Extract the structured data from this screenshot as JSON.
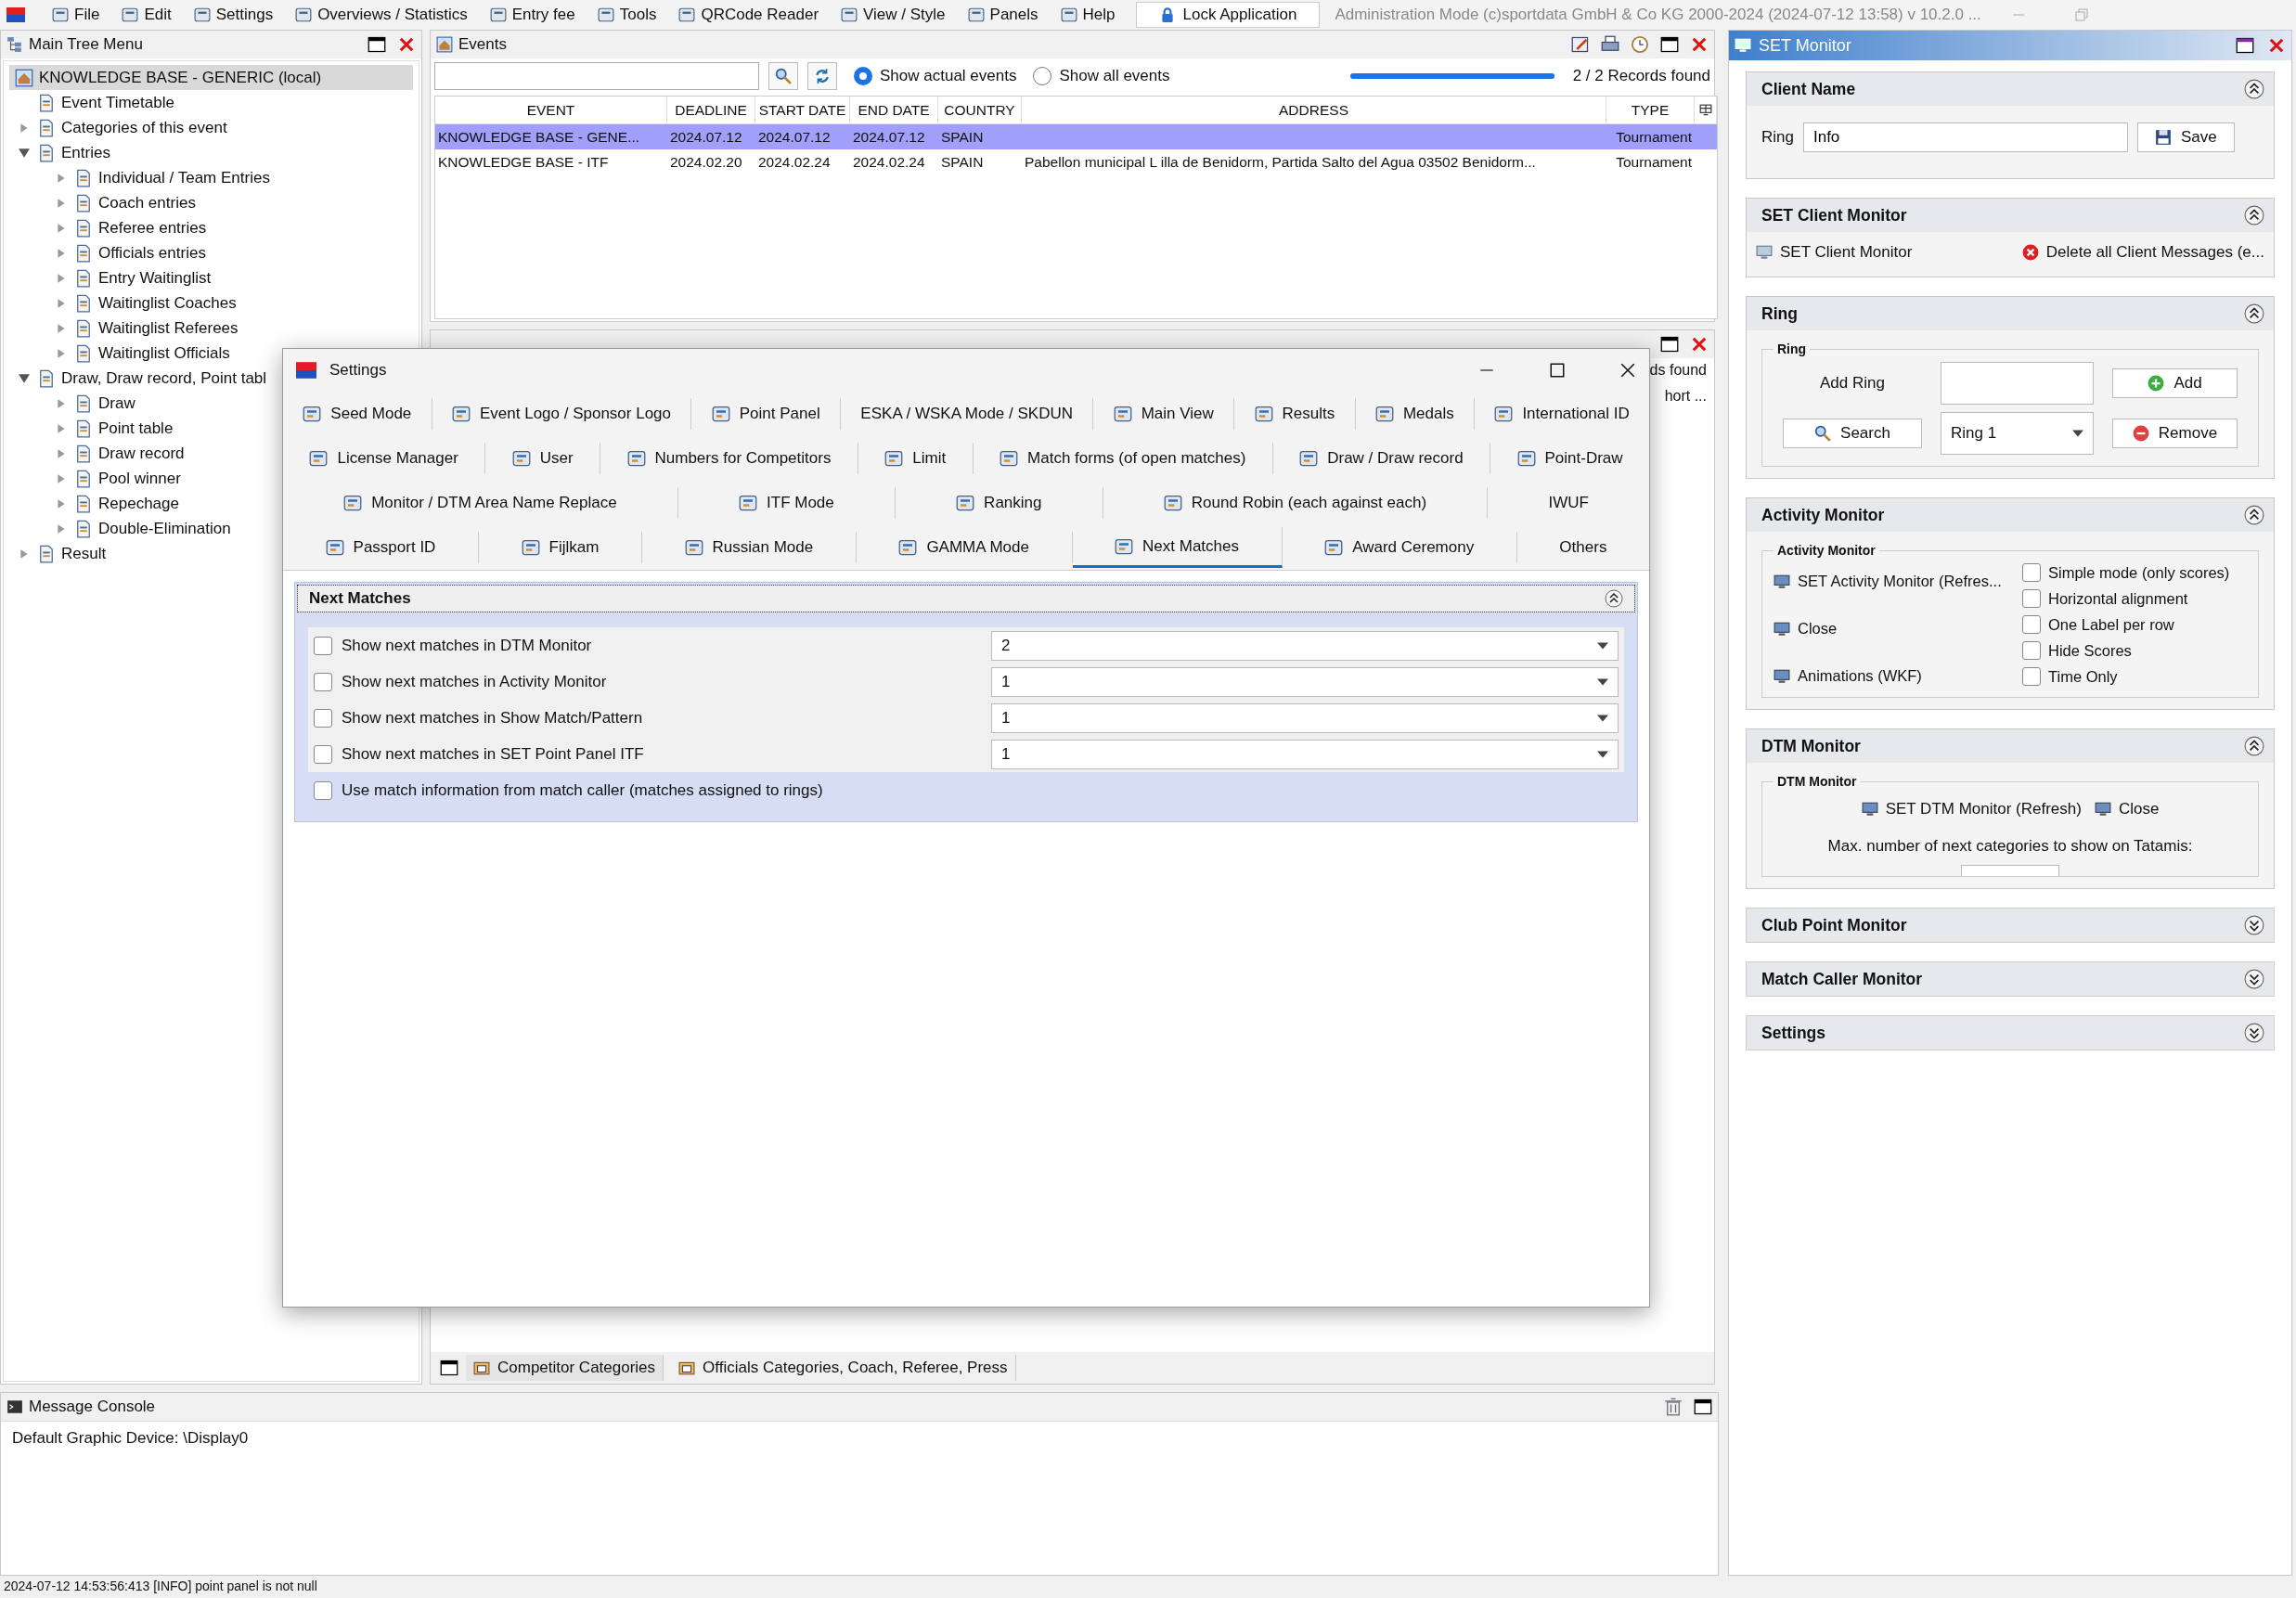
{
  "menu_bar": {
    "items": [
      "File",
      "Edit",
      "Settings",
      "Overviews / Statistics",
      "Entry fee",
      "Tools",
      "QRCode Reader",
      "View / Style",
      "Panels",
      "Help"
    ],
    "lock_button": "Lock Application",
    "caption": "Administration Mode (c)sportdata GmbH & Co KG 2000-2024 (2024-07-12 13:58)  v 10.2.0 ..."
  },
  "tree_panel": {
    "title": "Main Tree Menu",
    "root": {
      "label": "KNOWLEDGE BASE - GENERIC (local)",
      "selected": true
    },
    "items": [
      {
        "label": "Event Timetable",
        "kind": "leaf"
      },
      {
        "label": "Categories of this event",
        "kind": "node",
        "expanded": false
      },
      {
        "label": "Entries",
        "kind": "node",
        "expanded": true,
        "children": [
          {
            "label": "Individual / Team Entries",
            "kind": "node",
            "expanded": false
          },
          {
            "label": "Coach entries",
            "kind": "node",
            "expanded": false
          },
          {
            "label": "Referee entries",
            "kind": "node",
            "expanded": false
          },
          {
            "label": "Officials entries",
            "kind": "node",
            "expanded": false
          },
          {
            "label": "Entry Waitinglist",
            "kind": "node",
            "expanded": false
          },
          {
            "label": "Waitinglist Coaches",
            "kind": "node",
            "expanded": false
          },
          {
            "label": "Waitinglist Referees",
            "kind": "node",
            "expanded": false
          },
          {
            "label": "Waitinglist Officials",
            "kind": "node",
            "expanded": false
          }
        ]
      },
      {
        "label": "Draw, Draw record, Point tabl",
        "kind": "node",
        "expanded": true,
        "children": [
          {
            "label": "Draw",
            "kind": "node",
            "expanded": false
          },
          {
            "label": "Point table",
            "kind": "node",
            "expanded": false
          },
          {
            "label": "Draw record",
            "kind": "node",
            "expanded": false
          },
          {
            "label": "Pool winner",
            "kind": "node",
            "expanded": false
          },
          {
            "label": "Repechage",
            "kind": "node",
            "expanded": false
          },
          {
            "label": "Double-Elimination",
            "kind": "node",
            "expanded": false
          }
        ]
      },
      {
        "label": "Result",
        "kind": "node",
        "expanded": false
      }
    ]
  },
  "events_panel": {
    "title": "Events",
    "radios": [
      {
        "label": "Show actual events",
        "selected": true
      },
      {
        "label": "Show all events",
        "selected": false
      }
    ],
    "progress": {
      "level": 1
    },
    "record_count": "2 / 2 Records found",
    "columns": [
      "EVENT",
      "DEADLINE",
      "START DATE",
      "END DATE",
      "COUNTRY",
      "ADDRESS",
      "TYPE"
    ],
    "rows": [
      {
        "selected": true,
        "cells": [
          "KNOWLEDGE BASE - GENE...",
          "2024.07.12",
          "2024.07.12",
          "2024.07.12",
          "SPAIN",
          null,
          "Tournament"
        ]
      },
      {
        "selected": false,
        "cells": [
          "KNOWLEDGE BASE - ITF",
          "2024.02.20",
          "2024.02.24",
          "2024.02.24",
          "SPAIN",
          "Pabellon municipal L illa de Benidorm, Partida Salto del Agua 03502 Benidorm...",
          "Tournament"
        ]
      }
    ]
  },
  "categories_panel": {
    "record_count": "ds found",
    "column_header": "hort ...",
    "tabs": [
      {
        "label": "Competitor Categories",
        "selected": true
      },
      {
        "label": "Officials Categories, Coach, Referee, Press",
        "selected": false
      }
    ]
  },
  "settings_dialog": {
    "title": "Settings",
    "tab_rows": [
      [
        {
          "label": "Seed Mode",
          "icon": true,
          "selected": false
        },
        {
          "label": "Event Logo / Sponsor Logo",
          "icon": true,
          "selected": false
        },
        {
          "label": "Point Panel",
          "icon": true,
          "selected": false
        },
        {
          "label": "ESKA / WSKA Mode / SKDUN",
          "icon": false,
          "selected": false
        },
        {
          "label": "Main View",
          "icon": true,
          "selected": false
        },
        {
          "label": "Results",
          "icon": true,
          "selected": false
        },
        {
          "label": "Medals",
          "icon": true,
          "selected": false
        },
        {
          "label": "International ID",
          "icon": true,
          "selected": false
        }
      ],
      [
        {
          "label": "License Manager",
          "icon": true,
          "selected": false
        },
        {
          "label": "User",
          "icon": true,
          "selected": false
        },
        {
          "label": "Numbers for Competitors",
          "icon": true,
          "selected": false
        },
        {
          "label": "Limit",
          "icon": true,
          "selected": false
        },
        {
          "label": "Match forms (of open matches)",
          "icon": true,
          "selected": false
        },
        {
          "label": "Draw / Draw record",
          "icon": true,
          "selected": false
        },
        {
          "label": "Point-Draw",
          "icon": true,
          "selected": false
        }
      ],
      [
        {
          "label": "Monitor / DTM Area Name Replace",
          "icon": true,
          "selected": false
        },
        {
          "label": "ITF Mode",
          "icon": true,
          "selected": false
        },
        {
          "label": "Ranking",
          "icon": true,
          "selected": false
        },
        {
          "label": "Round Robin (each against each)",
          "icon": true,
          "selected": false
        },
        {
          "label": "IWUF",
          "icon": false,
          "selected": false
        }
      ],
      [
        {
          "label": "Passport ID",
          "icon": true,
          "selected": false
        },
        {
          "label": "Fijlkam",
          "icon": true,
          "selected": false
        },
        {
          "label": "Russian Mode",
          "icon": true,
          "selected": false
        },
        {
          "label": "GAMMA Mode",
          "icon": true,
          "selected": false
        },
        {
          "label": "Next Matches",
          "icon": true,
          "selected": true
        },
        {
          "label": "Award Ceremony",
          "icon": true,
          "selected": false
        },
        {
          "label": "Others",
          "icon": false,
          "selected": false
        }
      ]
    ],
    "section": {
      "title": "Next Matches",
      "expanded": true,
      "rows": [
        {
          "kind": "select",
          "label": "Show next matches in DTM Monitor",
          "checked": false,
          "value": "2"
        },
        {
          "kind": "select",
          "label": "Show next matches in Activity Monitor",
          "checked": false,
          "value": "1"
        },
        {
          "kind": "select",
          "label": "Show next matches in Show Match/Pattern",
          "checked": false,
          "value": "1"
        },
        {
          "kind": "select",
          "label": "Show next matches in SET Point Panel ITF",
          "checked": false,
          "value": "1"
        },
        {
          "kind": "check",
          "label": "Use match information from match caller (matches assigned to rings)",
          "checked": false
        }
      ]
    }
  },
  "message_console": {
    "title": "Message Console",
    "lines": [
      "Default Graphic Device: \\Display0"
    ]
  },
  "status_bar": "2024-07-12 14:53:56:413 [INFO] point panel is not null",
  "set_monitor": {
    "title": "SET Monitor",
    "sections": [
      {
        "kind": "client-name",
        "title": "Client Name",
        "expanded": true,
        "field_label": "Ring",
        "field_value": "Info",
        "button": "Save"
      },
      {
        "kind": "client-monitor",
        "title": "SET Client Monitor",
        "expanded": true,
        "actions": [
          "SET Client Monitor",
          "Delete all Client Messages (e..."
        ]
      },
      {
        "kind": "ring",
        "title": "Ring",
        "expanded": true,
        "group": "Ring",
        "add_label": "Add Ring",
        "add_button": "Add",
        "search_button": "Search",
        "ring_select": "Ring 1",
        "remove_button": "Remove"
      },
      {
        "kind": "activity",
        "title": "Activity Monitor",
        "expanded": true,
        "group": "Activity Monitor",
        "actions": [
          "SET Activity Monitor (Refres...",
          "Close",
          "Animations (WKF)"
        ],
        "options": [
          {
            "label": "Simple mode (only scores)",
            "checked": false
          },
          {
            "label": "Horizontal alignment",
            "checked": false
          },
          {
            "label": "One Label per row",
            "checked": false
          },
          {
            "label": "Hide Scores",
            "checked": false
          },
          {
            "label": "Time Only",
            "checked": false
          }
        ]
      },
      {
        "kind": "dtm",
        "title": "DTM Monitor",
        "expanded": true,
        "group": "DTM Monitor",
        "actions": [
          "SET DTM Monitor (Refresh)",
          "Close"
        ],
        "note": "Max. number of next categories to show on Tatamis:"
      },
      {
        "kind": "plain",
        "title": "Club Point Monitor",
        "expanded": false
      },
      {
        "kind": "plain",
        "title": "Match Caller Monitor",
        "expanded": false
      },
      {
        "kind": "plain",
        "title": "Settings",
        "expanded": false
      }
    ]
  }
}
